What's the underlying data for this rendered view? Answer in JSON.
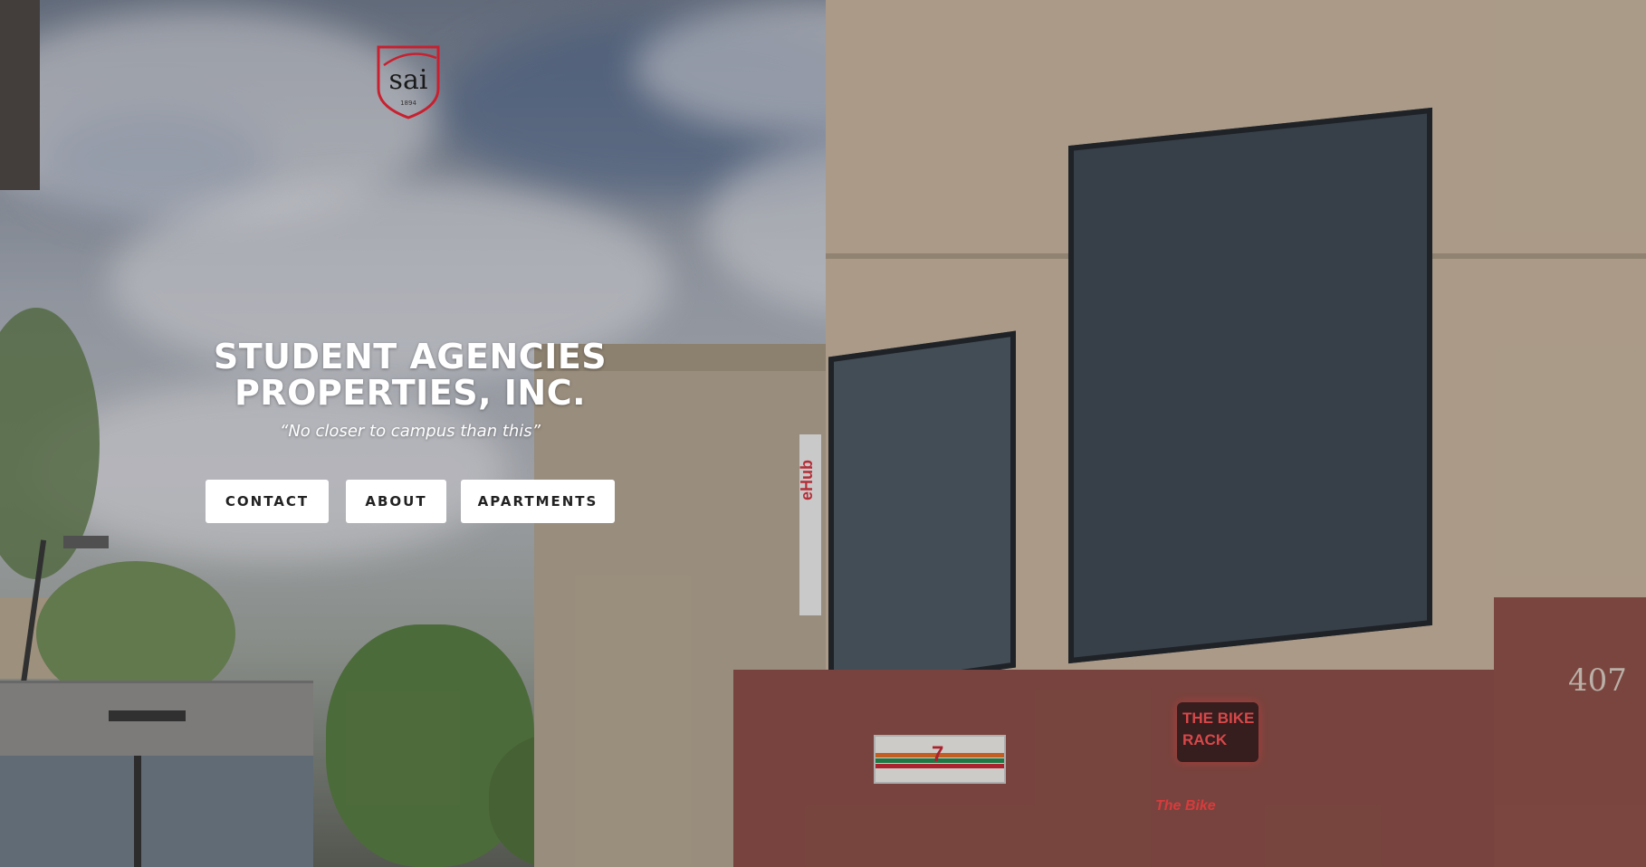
{
  "logo": {
    "monogram": "sai",
    "year": "1894",
    "accent_color": "#c8202f"
  },
  "hero": {
    "title": "STUDENT AGENCIES PROPERTIES, INC.",
    "tagline": "“No closer to campus than this”"
  },
  "nav": {
    "contact_label": "CONTACT",
    "about_label": "ABOUT",
    "apartments_label": "APARTMENTS"
  },
  "photo": {
    "ehub_sign": "eHub",
    "bike_rack_sign": "THE BIKE RACK",
    "bike_store_sign": "The Bike",
    "seven_eleven_sign": "7",
    "street_number": "407"
  }
}
